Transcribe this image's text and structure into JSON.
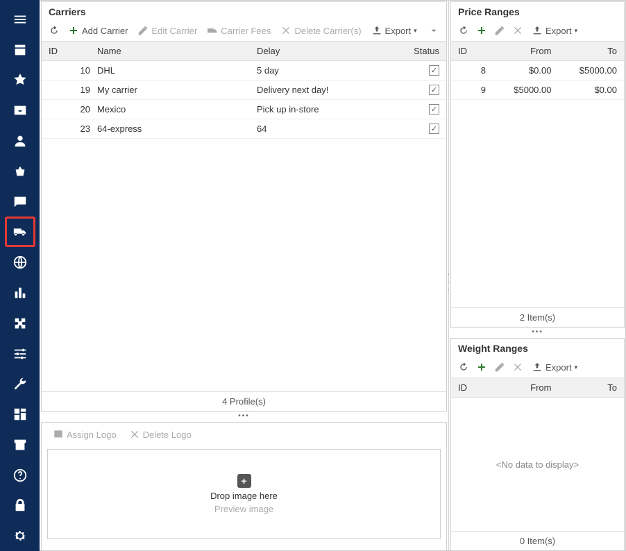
{
  "carriers": {
    "title": "Carriers",
    "toolbar": {
      "refresh": "",
      "add": "Add Carrier",
      "edit": "Edit Carrier",
      "fees": "Carrier Fees",
      "del": "Delete Carrier(s)",
      "export": "Export"
    },
    "headers": {
      "id": "ID",
      "name": "Name",
      "delay": "Delay",
      "status": "Status"
    },
    "rows": [
      {
        "id": "10",
        "name": "DHL",
        "delay": "5 day",
        "status": true
      },
      {
        "id": "19",
        "name": "My carrier",
        "delay": "Delivery next day!",
        "status": true
      },
      {
        "id": "20",
        "name": "Mexico",
        "delay": "Pick up in-store",
        "status": true
      },
      {
        "id": "23",
        "name": "64-express",
        "delay": "64",
        "status": true
      }
    ],
    "footer": "4 Profile(s)"
  },
  "logo": {
    "assign": "Assign Logo",
    "del": "Delete Logo",
    "dropText": "Drop image here",
    "preview": "Preview image"
  },
  "price": {
    "title": "Price Ranges",
    "export": "Export",
    "headers": {
      "id": "ID",
      "from": "From",
      "to": "To"
    },
    "rows": [
      {
        "id": "8",
        "from": "$0.00",
        "to": "$5000.00"
      },
      {
        "id": "9",
        "from": "$5000.00",
        "to": "$0.00"
      }
    ],
    "footer": "2 Item(s)"
  },
  "weight": {
    "title": "Weight Ranges",
    "export": "Export",
    "headers": {
      "id": "ID",
      "from": "From",
      "to": "To"
    },
    "nodata": "<No data to display>",
    "footer": "0 Item(s)"
  }
}
